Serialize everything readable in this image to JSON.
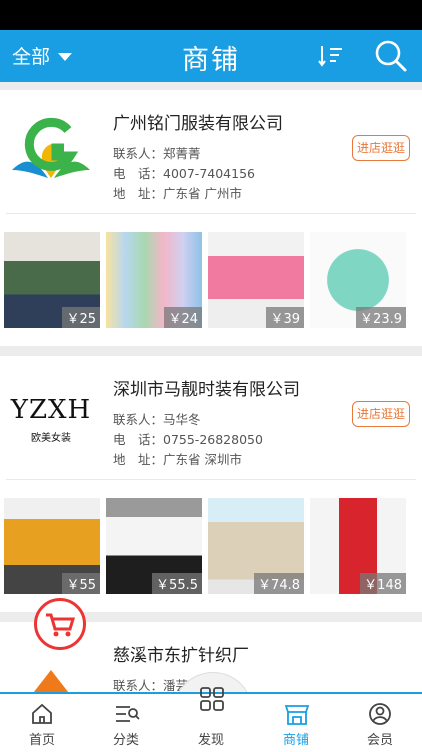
{
  "header": {
    "filter_label": "全部",
    "title": "商铺"
  },
  "shops": [
    {
      "name": "广州铭门服装有限公司",
      "contact_label": "联系人：",
      "contact": "郑菁菁",
      "phone_label": "电　话：",
      "phone": "4007-7404156",
      "address_label": "地　址：",
      "address": "广东省 广州市",
      "enter_label": "进店逛逛",
      "products": [
        {
          "price": "￥25",
          "color": "#4a6b4a"
        },
        {
          "price": "￥24",
          "color": "#b7d7ef"
        },
        {
          "price": "￥39",
          "color": "#f07aa0"
        },
        {
          "price": "￥23.9",
          "color": "#7fd6c3"
        }
      ]
    },
    {
      "name": "深圳市马靓时装有限公司",
      "logo_text": "YZXH",
      "logo_sub": "欧美女装",
      "contact_label": "联系人：",
      "contact": "马华冬",
      "phone_label": "电　话：",
      "phone": "0755-26828050",
      "address_label": "地　址：",
      "address": "广东省 深圳市",
      "enter_label": "进店逛逛",
      "products": [
        {
          "price": "￥55",
          "color": "#e8a020"
        },
        {
          "price": "￥55.5",
          "color": "#9a9a9a"
        },
        {
          "price": "￥74.8",
          "color": "#dcd0b8"
        },
        {
          "price": "￥148",
          "color": "#d8242c"
        }
      ]
    },
    {
      "name": "慈溪市东扩针织厂",
      "contact_label": "联系人：",
      "contact": "潘芸芸"
    }
  ],
  "tabs": [
    {
      "label": "首页",
      "icon": "home-icon"
    },
    {
      "label": "分类",
      "icon": "category-icon"
    },
    {
      "label": "发现",
      "icon": "discover-icon"
    },
    {
      "label": "商铺",
      "icon": "shop-icon",
      "active": true
    },
    {
      "label": "会员",
      "icon": "member-icon"
    }
  ],
  "colors": {
    "primary": "#1a9ee3",
    "accent": "#e8793a"
  }
}
